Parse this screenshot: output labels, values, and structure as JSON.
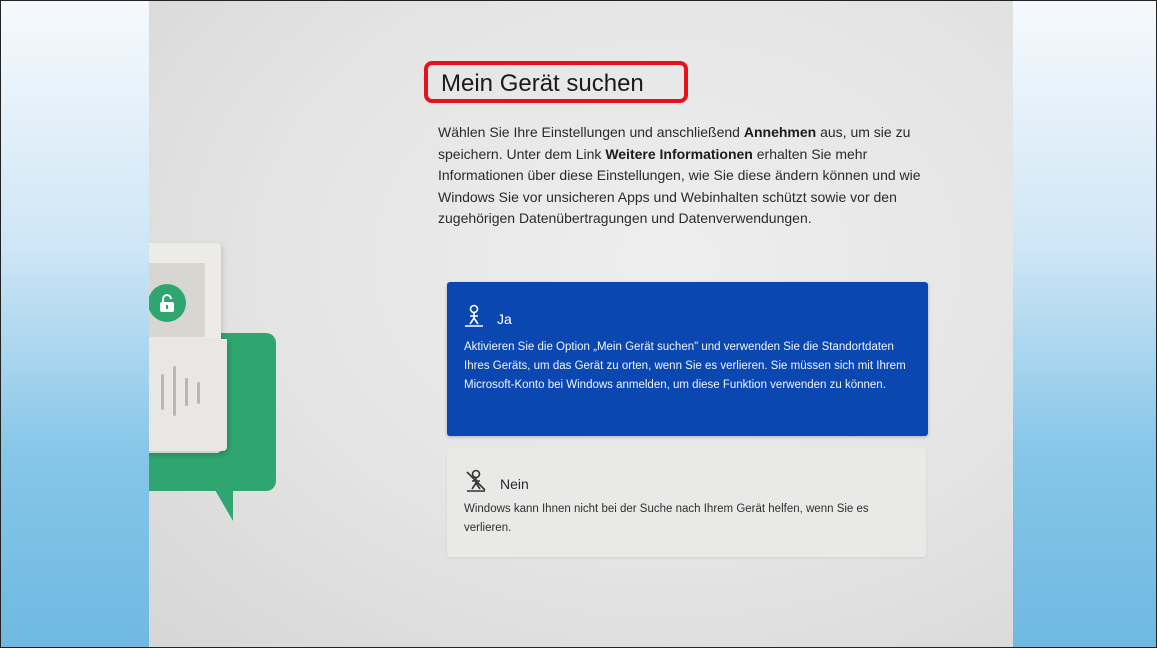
{
  "page": {
    "title": "Mein Gerät suchen",
    "intro": {
      "part1": "Wählen Sie Ihre Einstellungen und anschließend ",
      "accept_label": "Annehmen",
      "part2": " aus, um sie zu speichern. Unter dem Link ",
      "learn_more_label": "Weitere Informationen",
      "part3": " erhalten Sie mehr Informationen über diese Einstellungen, wie Sie diese ändern können und wie Windows Sie vor unsicheren Apps und Webinhalten schützt sowie vor den zugehörigen Datenübertragungen und Datenverwendungen."
    }
  },
  "options": {
    "yes": {
      "label": "Ja",
      "icon": "location-person-icon",
      "description": "Aktivieren Sie die Option „Mein Gerät suchen\" und verwenden Sie die Standortdaten Ihres Geräts, um das Gerät zu orten, wenn Sie es verlieren. Sie müssen sich mit Ihrem Microsoft-Konto bei Windows anmelden, um diese Funktion verwenden zu können.",
      "selected": true
    },
    "no": {
      "label": "Nein",
      "icon": "location-off-icon",
      "description": "Windows kann Ihnen nicht bei der Suche nach Ihrem Gerät helfen, wenn Sie es verlieren.",
      "selected": false
    }
  },
  "colors": {
    "selected_option": "#0a47b0",
    "highlight_box": "#e8101a",
    "illustration_green": "#2fa570"
  }
}
